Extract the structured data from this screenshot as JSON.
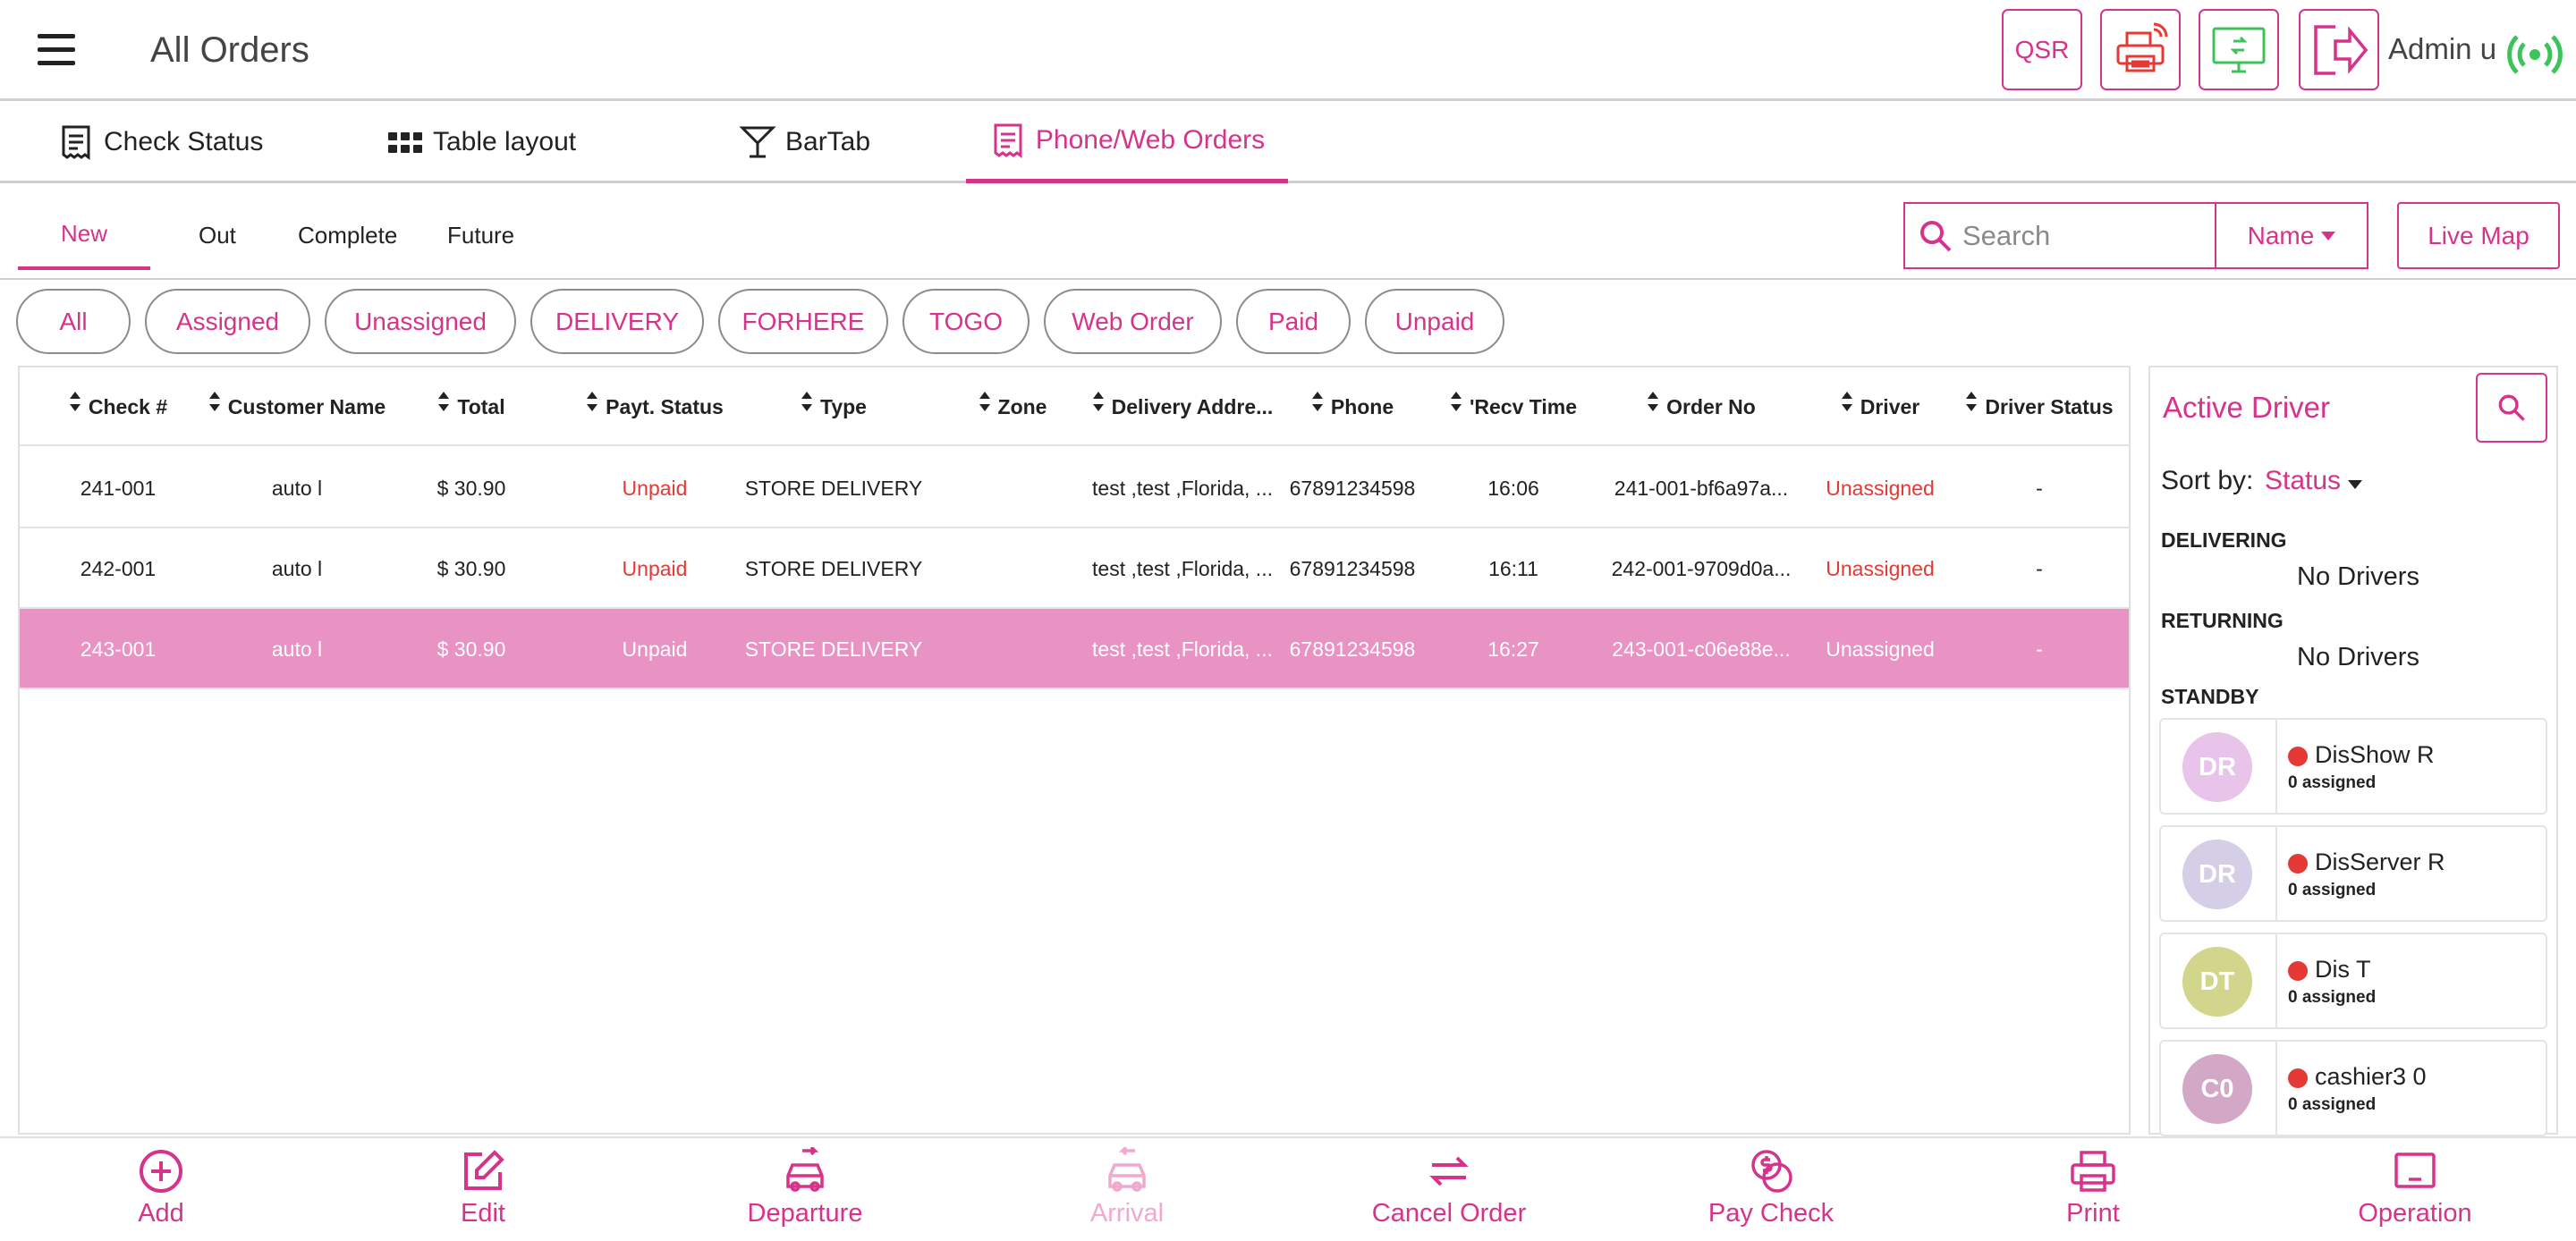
{
  "header": {
    "title": "All Orders",
    "qsr_label": "QSR",
    "admin_name": "Admin u"
  },
  "main_tabs": [
    {
      "label": "Check Status",
      "icon": "receipt-icon"
    },
    {
      "label": "Table layout",
      "icon": "grid-icon"
    },
    {
      "label": "BarTab",
      "icon": "cocktail-icon"
    },
    {
      "label": "Phone/Web Orders",
      "icon": "receipt-icon",
      "active": true
    }
  ],
  "sub_tabs": [
    {
      "label": "New",
      "active": true
    },
    {
      "label": "Out"
    },
    {
      "label": "Complete"
    },
    {
      "label": "Future"
    }
  ],
  "search": {
    "placeholder": "Search",
    "value": ""
  },
  "search_by": "Name",
  "live_map_label": "Live Map",
  "filters": [
    "All",
    "Assigned",
    "Unassigned",
    "DELIVERY",
    "FORHERE",
    "TOGO",
    "Web Order",
    "Paid",
    "Unpaid"
  ],
  "table": {
    "columns": [
      "Check #",
      "Customer Name",
      "Total",
      "Payt. Status",
      "Type",
      "Zone",
      "Delivery Addre...",
      "Phone",
      "'Recv Time",
      "Order No",
      "Driver",
      "Driver Status"
    ],
    "rows": [
      {
        "check": "241-001",
        "customer": "auto l",
        "total": "$ 30.90",
        "status": "Unpaid",
        "type": "STORE DELIVERY",
        "zone": "",
        "address": "test ,test ,Florida, ...",
        "phone": "67891234598",
        "recv": "16:06",
        "order": "241-001-bf6a97a...",
        "driver": "Unassigned",
        "driver_status": "-",
        "selected": false
      },
      {
        "check": "242-001",
        "customer": "auto l",
        "total": "$ 30.90",
        "status": "Unpaid",
        "type": "STORE DELIVERY",
        "zone": "",
        "address": "test ,test ,Florida, ...",
        "phone": "67891234598",
        "recv": "16:11",
        "order": "242-001-9709d0a...",
        "driver": "Unassigned",
        "driver_status": "-",
        "selected": false
      },
      {
        "check": "243-001",
        "customer": "auto l",
        "total": "$ 30.90",
        "status": "Unpaid",
        "type": "STORE DELIVERY",
        "zone": "",
        "address": "test ,test ,Florida, ...",
        "phone": "67891234598",
        "recv": "16:27",
        "order": "243-001-c06e88e...",
        "driver": "Unassigned",
        "driver_status": "-",
        "selected": true
      }
    ]
  },
  "driver_panel": {
    "title": "Active Driver",
    "sort_label": "Sort by:",
    "sort_value": "Status",
    "delivering_label": "DELIVERING",
    "delivering_empty": "No Drivers",
    "returning_label": "RETURNING",
    "returning_empty": "No Drivers",
    "standby_label": "STANDBY",
    "drivers": [
      {
        "initials": "DR",
        "name": "DisShow R",
        "assigned": "0 assigned",
        "color": "#e8c4ea"
      },
      {
        "initials": "DR",
        "name": "DisServer R",
        "assigned": "0 assigned",
        "color": "#d4cee6"
      },
      {
        "initials": "DT",
        "name": "Dis T",
        "assigned": "0 assigned",
        "color": "#d2d68c"
      },
      {
        "initials": "C0",
        "name": "cashier3 0",
        "assigned": "0 assigned",
        "color": "#d2a8c6"
      }
    ]
  },
  "bottom_bar": [
    {
      "label": "Add",
      "icon": "plus-circle-icon",
      "enabled": true
    },
    {
      "label": "Edit",
      "icon": "edit-icon",
      "enabled": true
    },
    {
      "label": "Departure",
      "icon": "car-depart-icon",
      "enabled": true
    },
    {
      "label": "Arrival",
      "icon": "car-arrive-icon",
      "enabled": false
    },
    {
      "label": "Cancel Order",
      "icon": "swap-icon",
      "enabled": true
    },
    {
      "label": "Pay Check",
      "icon": "coins-icon",
      "enabled": true
    },
    {
      "label": "Print",
      "icon": "printer-icon",
      "enabled": true
    },
    {
      "label": "Operation",
      "icon": "monitor-icon",
      "enabled": true
    }
  ],
  "colors": {
    "accent": "#d6338a",
    "unpaid": "#e53935",
    "selected_row": "#e992c4",
    "online": "#3cc35a"
  }
}
